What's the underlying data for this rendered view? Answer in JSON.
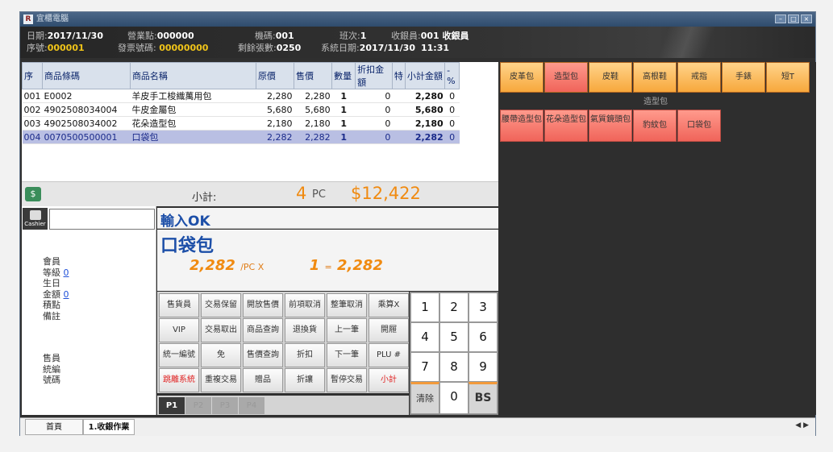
{
  "app": {
    "title": "宜櫃電腦",
    "logo": "R"
  },
  "header": {
    "date_label": "日期:",
    "date": "2017/11/30",
    "store_label": "營業點:",
    "store": "000000",
    "machine_label": "機碼:",
    "machine": "001",
    "shift_label": "班次:",
    "shift": "1",
    "cashier_label": "收銀員:",
    "cashier": "001 收銀員",
    "seq_label": "序號:",
    "seq": "000001",
    "invoice_label": "發票號碼:",
    "invoice": "00000000",
    "remaining_label": "剩餘張數:",
    "remaining": "0250",
    "sysdate_label": "系統日期:",
    "sysdate": "2017/11/30",
    "systime": "11:31"
  },
  "table": {
    "headers": [
      "序",
      "商品條碼",
      "商品名稱",
      "原價",
      "售價",
      "數量",
      "折扣金額",
      "特",
      "小計金額",
      "-%"
    ],
    "rows": [
      [
        "001",
        "E0002",
        "羊皮手工梭織萬用包",
        "2,280",
        "2,280",
        "1",
        "0",
        "",
        "2,280",
        "0"
      ],
      [
        "002",
        "4902508034004",
        "牛皮金屬包",
        "5,680",
        "5,680",
        "1",
        "0",
        "",
        "5,680",
        "0"
      ],
      [
        "003",
        "4902508034002",
        "花朵造型包",
        "2,180",
        "2,180",
        "1",
        "0",
        "",
        "2,180",
        "0"
      ],
      [
        "004",
        "0070500500001",
        "口袋包",
        "2,282",
        "2,282",
        "1",
        "0",
        "",
        "2,282",
        "0"
      ]
    ],
    "selected_row": 3
  },
  "subtotal": {
    "label": "小計:",
    "count": "4",
    "unit": "PC",
    "amount": "$12,422"
  },
  "left_panel": {
    "cashier_icon_label": "Cashier",
    "member_label": "會員",
    "level_label": "等級",
    "level": "0",
    "birthday_label": "生日",
    "amount_label": "金額",
    "amount": "0",
    "points_label": "積點",
    "note_label": "備註",
    "sales_label": "售員",
    "uniform_label": "統編",
    "number_label": "號碼"
  },
  "message": {
    "status": "輸入OK",
    "product": "口袋包",
    "price": "2,282",
    "per_unit": "/PC X",
    "qty": "1",
    "eq": "=",
    "total": "2,282"
  },
  "function_keys": [
    [
      "售貨員",
      "交易保留",
      "開放售價",
      "前項取消",
      "整筆取消",
      "乘算X"
    ],
    [
      "VIP",
      "交易取出",
      "商品查詢",
      "退換貨",
      "上一筆",
      "開屜"
    ],
    [
      "統一編號",
      "免",
      "售價查詢",
      "折扣",
      "下一筆",
      "PLU #"
    ],
    [
      "跳離系統",
      "重複交易",
      "贈品",
      "折讓",
      "暫停交易",
      "小計"
    ]
  ],
  "pages": [
    "P1",
    "P2",
    "P3",
    "P4"
  ],
  "numpad": [
    "1",
    "2",
    "3",
    "4",
    "5",
    "6",
    "7",
    "8",
    "9",
    "清除",
    "0",
    "BS"
  ],
  "categories": [
    "皮革包",
    "造型包",
    "皮鞋",
    "高根鞋",
    "戒指",
    "手錶",
    "短T"
  ],
  "subcategory_title": "造型包",
  "subcategories": [
    "腰帶造型包",
    "花朵造型包",
    "氣質鏡頭包",
    "豹紋包",
    "口袋包"
  ],
  "tabs": [
    "首頁",
    "1.收銀作業"
  ],
  "colors": {
    "accent_orange": "#f08a10",
    "blue_text": "#1d4fa8",
    "selected_row": "#b9bfe3"
  }
}
